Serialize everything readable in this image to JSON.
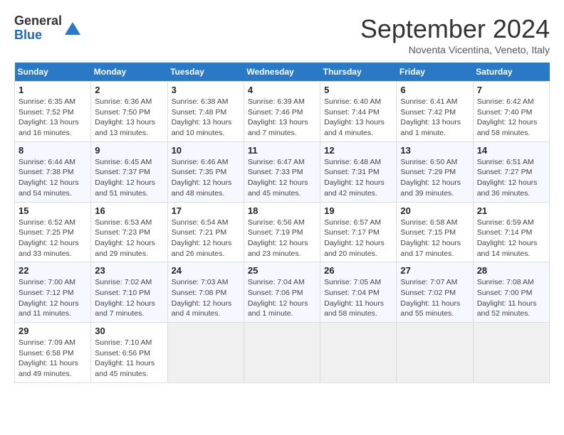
{
  "header": {
    "logo_general": "General",
    "logo_blue": "Blue",
    "month_title": "September 2024",
    "location": "Noventa Vicentina, Veneto, Italy"
  },
  "days_of_week": [
    "Sunday",
    "Monday",
    "Tuesday",
    "Wednesday",
    "Thursday",
    "Friday",
    "Saturday"
  ],
  "weeks": [
    [
      {
        "num": "1",
        "info": "Sunrise: 6:35 AM\nSunset: 7:52 PM\nDaylight: 13 hours\nand 16 minutes."
      },
      {
        "num": "2",
        "info": "Sunrise: 6:36 AM\nSunset: 7:50 PM\nDaylight: 13 hours\nand 13 minutes."
      },
      {
        "num": "3",
        "info": "Sunrise: 6:38 AM\nSunset: 7:48 PM\nDaylight: 13 hours\nand 10 minutes."
      },
      {
        "num": "4",
        "info": "Sunrise: 6:39 AM\nSunset: 7:46 PM\nDaylight: 13 hours\nand 7 minutes."
      },
      {
        "num": "5",
        "info": "Sunrise: 6:40 AM\nSunset: 7:44 PM\nDaylight: 13 hours\nand 4 minutes."
      },
      {
        "num": "6",
        "info": "Sunrise: 6:41 AM\nSunset: 7:42 PM\nDaylight: 13 hours\nand 1 minute."
      },
      {
        "num": "7",
        "info": "Sunrise: 6:42 AM\nSunset: 7:40 PM\nDaylight: 12 hours\nand 58 minutes."
      }
    ],
    [
      {
        "num": "8",
        "info": "Sunrise: 6:44 AM\nSunset: 7:38 PM\nDaylight: 12 hours\nand 54 minutes."
      },
      {
        "num": "9",
        "info": "Sunrise: 6:45 AM\nSunset: 7:37 PM\nDaylight: 12 hours\nand 51 minutes."
      },
      {
        "num": "10",
        "info": "Sunrise: 6:46 AM\nSunset: 7:35 PM\nDaylight: 12 hours\nand 48 minutes."
      },
      {
        "num": "11",
        "info": "Sunrise: 6:47 AM\nSunset: 7:33 PM\nDaylight: 12 hours\nand 45 minutes."
      },
      {
        "num": "12",
        "info": "Sunrise: 6:48 AM\nSunset: 7:31 PM\nDaylight: 12 hours\nand 42 minutes."
      },
      {
        "num": "13",
        "info": "Sunrise: 6:50 AM\nSunset: 7:29 PM\nDaylight: 12 hours\nand 39 minutes."
      },
      {
        "num": "14",
        "info": "Sunrise: 6:51 AM\nSunset: 7:27 PM\nDaylight: 12 hours\nand 36 minutes."
      }
    ],
    [
      {
        "num": "15",
        "info": "Sunrise: 6:52 AM\nSunset: 7:25 PM\nDaylight: 12 hours\nand 33 minutes."
      },
      {
        "num": "16",
        "info": "Sunrise: 6:53 AM\nSunset: 7:23 PM\nDaylight: 12 hours\nand 29 minutes."
      },
      {
        "num": "17",
        "info": "Sunrise: 6:54 AM\nSunset: 7:21 PM\nDaylight: 12 hours\nand 26 minutes."
      },
      {
        "num": "18",
        "info": "Sunrise: 6:56 AM\nSunset: 7:19 PM\nDaylight: 12 hours\nand 23 minutes."
      },
      {
        "num": "19",
        "info": "Sunrise: 6:57 AM\nSunset: 7:17 PM\nDaylight: 12 hours\nand 20 minutes."
      },
      {
        "num": "20",
        "info": "Sunrise: 6:58 AM\nSunset: 7:15 PM\nDaylight: 12 hours\nand 17 minutes."
      },
      {
        "num": "21",
        "info": "Sunrise: 6:59 AM\nSunset: 7:14 PM\nDaylight: 12 hours\nand 14 minutes."
      }
    ],
    [
      {
        "num": "22",
        "info": "Sunrise: 7:00 AM\nSunset: 7:12 PM\nDaylight: 12 hours\nand 11 minutes."
      },
      {
        "num": "23",
        "info": "Sunrise: 7:02 AM\nSunset: 7:10 PM\nDaylight: 12 hours\nand 7 minutes."
      },
      {
        "num": "24",
        "info": "Sunrise: 7:03 AM\nSunset: 7:08 PM\nDaylight: 12 hours\nand 4 minutes."
      },
      {
        "num": "25",
        "info": "Sunrise: 7:04 AM\nSunset: 7:06 PM\nDaylight: 12 hours\nand 1 minute."
      },
      {
        "num": "26",
        "info": "Sunrise: 7:05 AM\nSunset: 7:04 PM\nDaylight: 11 hours\nand 58 minutes."
      },
      {
        "num": "27",
        "info": "Sunrise: 7:07 AM\nSunset: 7:02 PM\nDaylight: 11 hours\nand 55 minutes."
      },
      {
        "num": "28",
        "info": "Sunrise: 7:08 AM\nSunset: 7:00 PM\nDaylight: 11 hours\nand 52 minutes."
      }
    ],
    [
      {
        "num": "29",
        "info": "Sunrise: 7:09 AM\nSunset: 6:58 PM\nDaylight: 11 hours\nand 49 minutes."
      },
      {
        "num": "30",
        "info": "Sunrise: 7:10 AM\nSunset: 6:56 PM\nDaylight: 11 hours\nand 45 minutes."
      },
      {
        "num": "",
        "info": ""
      },
      {
        "num": "",
        "info": ""
      },
      {
        "num": "",
        "info": ""
      },
      {
        "num": "",
        "info": ""
      },
      {
        "num": "",
        "info": ""
      }
    ]
  ]
}
